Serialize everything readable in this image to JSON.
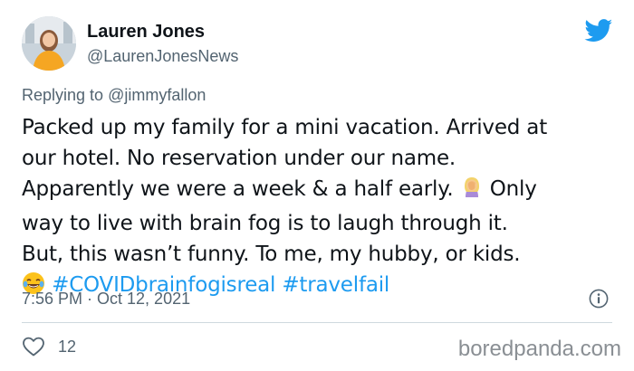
{
  "author": {
    "name": "Lauren Jones",
    "handle": "@LaurenJonesNews"
  },
  "reply": {
    "prefix": "Replying to ",
    "mention": "@jimmyfallon"
  },
  "tweet": {
    "lines": [
      "Packed up my family for a mini vacation. Arrived at",
      "our hotel. No reservation under our name.",
      "Apparently we were a week & a half early.",
      "Only",
      "way to live with brain fog is to laugh through it.",
      "But, this wasn’t funny. To me, my hubby, or kids."
    ],
    "hashtags": [
      "#COVIDbrainfogisreal",
      "#travelfail"
    ],
    "emojis": [
      "woman-facepalming",
      "laughing-crying"
    ]
  },
  "meta": {
    "timestamp": "7:56 PM · Oct 12, 2021"
  },
  "actions": {
    "like_count": "12"
  },
  "watermark": "boredpanda.com",
  "colors": {
    "text": "#0f1419",
    "secondary": "#536471",
    "accent": "#1d9bf0",
    "divider": "#cfd9de"
  },
  "icons": {
    "brand": "twitter-bird-icon",
    "info": "info-icon",
    "like": "heart-icon"
  }
}
